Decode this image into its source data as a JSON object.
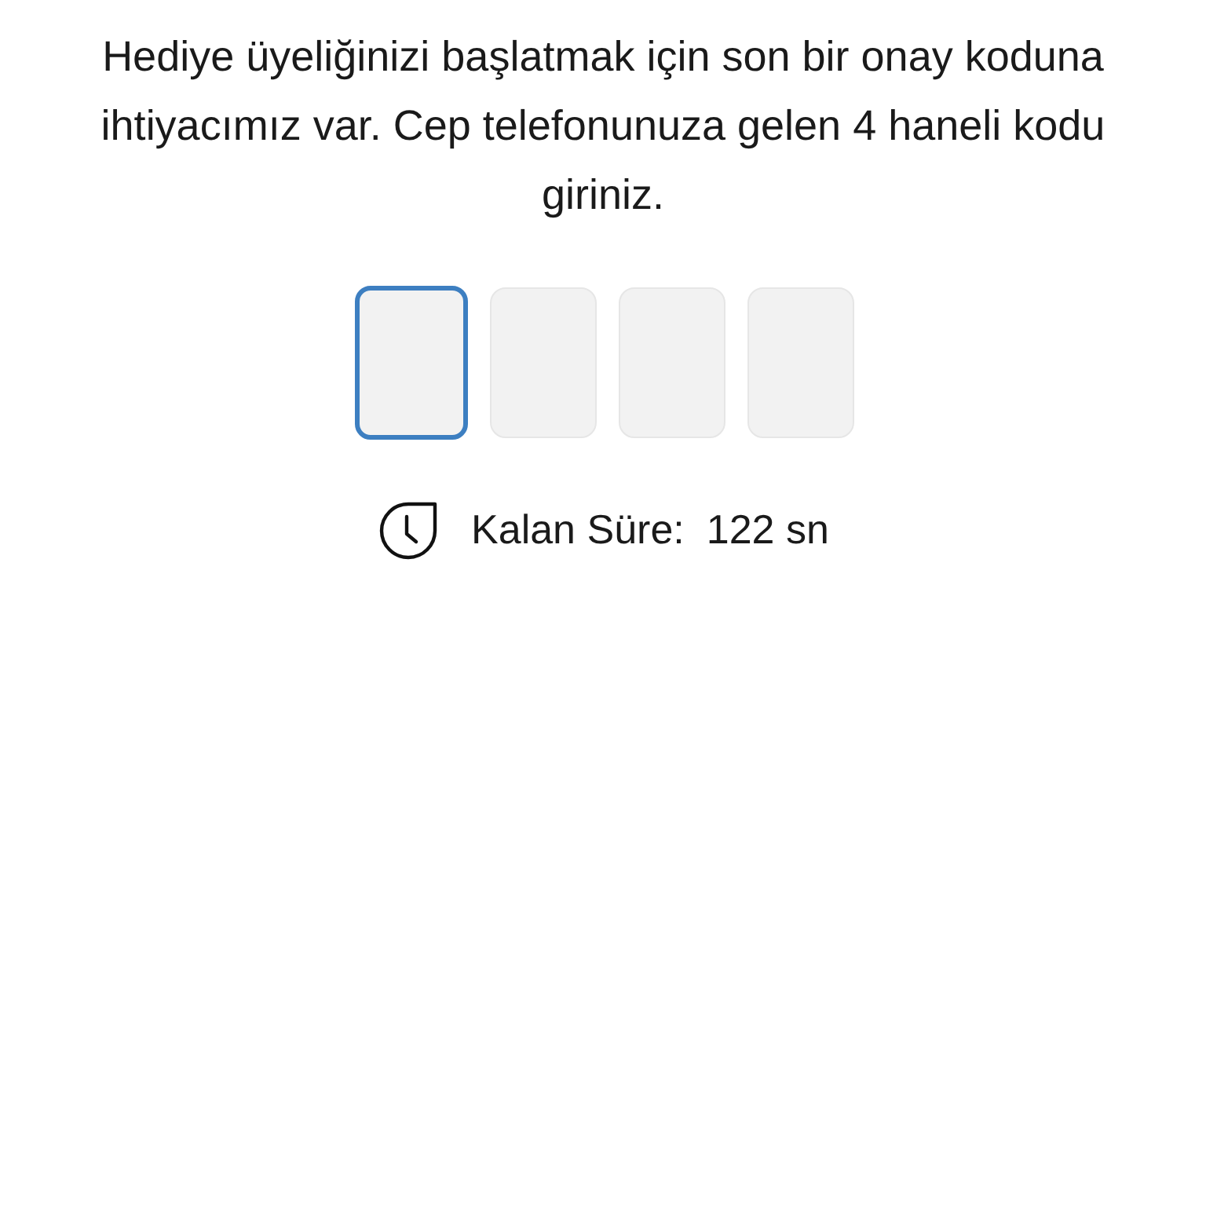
{
  "message": "Hediye üyeliğinizi başlatmak için son bir onay koduna ihtiyacımız var. Cep telefonunuza gelen 4 haneli kodu giriniz.",
  "code_inputs": [
    {
      "selected": true
    },
    {
      "selected": false
    },
    {
      "selected": false
    },
    {
      "selected": false
    }
  ],
  "timer": {
    "label": "Kalan Süre:",
    "value": "122 sn"
  }
}
